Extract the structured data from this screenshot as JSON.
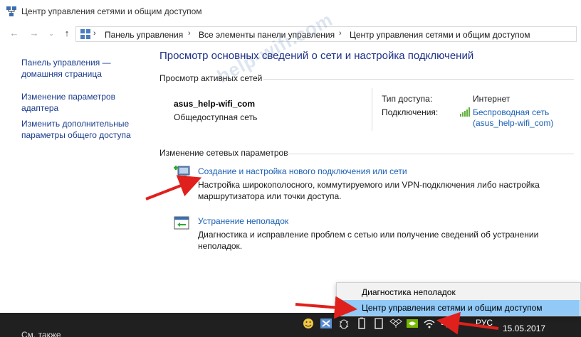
{
  "window": {
    "title": "Центр управления сетями и общим доступом"
  },
  "address_bar": {
    "breadcrumbs": [
      "Панель управления",
      "Все элементы панели управления",
      "Центр управления сетями и общим доступом"
    ]
  },
  "sidebar": {
    "items": [
      {
        "label": "Панель управления — домашняя страница"
      },
      {
        "label": "Изменение параметров адаптера"
      },
      {
        "label": "Изменить дополнительные параметры общего доступа"
      }
    ]
  },
  "main": {
    "heading": "Просмотр основных сведений о сети и настройка подключений",
    "active_networks_title": "Просмотр активных сетей",
    "network": {
      "name": "asus_help-wifi_com",
      "type": "Общедоступная сеть",
      "access_label": "Тип доступа:",
      "access_value": "Интернет",
      "connections_label": "Подключения:",
      "connection_link_line1": "Беспроводная сеть",
      "connection_link_line2": "(asus_help-wifi_com)"
    },
    "change_title": "Изменение сетевых параметров",
    "tasks": [
      {
        "title": "Создание и настройка нового подключения или сети",
        "desc_line1": "Настройка широкополосного, коммутируемого или VPN-подключения либо настройка",
        "desc_line2": "маршрутизатора или точки доступа."
      },
      {
        "title": "Устранение неполадок",
        "desc_line1": "Диагностика и исправление проблем с сетью или получение сведений об устранении",
        "desc_line2": "неполадок."
      }
    ]
  },
  "watermark": "help-wifi.com",
  "context_menu": {
    "items": [
      {
        "label": "Диагностика неполадок"
      },
      {
        "label": "Центр управления сетями и общим доступом"
      }
    ]
  },
  "taskbar": {
    "left_text": "См. также",
    "language": "РУС",
    "date": "15.05.2017"
  },
  "colors": {
    "link": "#1a5fb4",
    "heading": "#1e3287",
    "highlight": "#91c9f7",
    "arrow": "#e0201c",
    "taskbar": "#202020"
  }
}
